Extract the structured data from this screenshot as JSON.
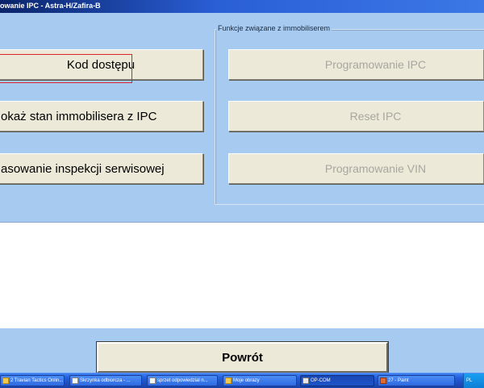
{
  "window": {
    "title": "owanie IPC - Astra-H/Zafira-B"
  },
  "left_buttons": {
    "access_code": "Kod dostępu",
    "show_immobiliser": "okaż stan immobilisera z IPC",
    "reset_service": "asowanie inspekcji serwisowej"
  },
  "immobiliser_group": {
    "legend": "Funkcje związane z immobiliserem",
    "program_ipc": "Programowanie IPC",
    "reset_ipc": "Reset IPC",
    "program_vin": "Programowanie VIN"
  },
  "footer": {
    "back_button": "Powrót"
  },
  "taskbar": {
    "items": [
      {
        "label": "2 Travian Tactics Onlin...",
        "icon": "browser-icon"
      },
      {
        "label": "Skrzynka odbiorcza - ...",
        "icon": "mail-icon"
      },
      {
        "label": "sprzet odpowiedzial n...",
        "icon": "document-icon"
      },
      {
        "label": "Moje obrazy",
        "icon": "folder-icon"
      },
      {
        "label": "OP-COM",
        "icon": "app-icon"
      },
      {
        "label": "27 - Paint",
        "icon": "paint-icon"
      }
    ],
    "tray_text": "PL"
  },
  "colors": {
    "panel_background": "#a6caf0",
    "button_face": "#ece9d8",
    "focus_rect": "#e0202a",
    "disabled_text": "#a8a79e"
  }
}
